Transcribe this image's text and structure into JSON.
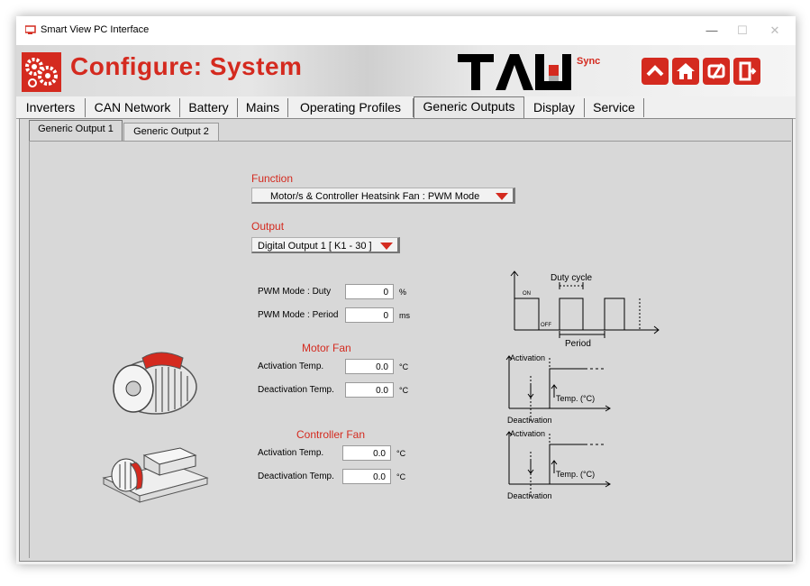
{
  "window": {
    "title": "Smart View PC Interface",
    "minimize": "—",
    "maximize": "☐",
    "close": "✕"
  },
  "header": {
    "page_title": "Configure: System",
    "brand": "TAU",
    "brand_sup": "Sync",
    "accent": "#d42a1f"
  },
  "tabs": [
    {
      "label": "Inverters"
    },
    {
      "label": "CAN Network"
    },
    {
      "label": "Battery"
    },
    {
      "label": "Mains"
    },
    {
      "label": "Operating Profiles"
    },
    {
      "label": "Generic Outputs"
    },
    {
      "label": "Display"
    },
    {
      "label": "Service"
    }
  ],
  "subtabs": [
    {
      "label": "Generic Output 1"
    },
    {
      "label": "Generic Output 2"
    }
  ],
  "function": {
    "label": "Function",
    "value": "Motor/s & Controller Heatsink Fan : PWM Mode"
  },
  "output": {
    "label": "Output",
    "value": "Digital Output 1  [ K1 - 30 ]"
  },
  "pwm": {
    "duty_label": "PWM Mode : Duty",
    "duty_value": "0",
    "duty_unit": "%",
    "period_label": "PWM Mode : Period",
    "period_value": "0",
    "period_unit": "ms"
  },
  "motor_fan": {
    "title": "Motor Fan",
    "activation_label": "Activation Temp.",
    "activation_value": "0.0",
    "activation_unit": "°C",
    "deactivation_label": "Deactivation Temp.",
    "deactivation_value": "0.0",
    "deactivation_unit": "°C"
  },
  "controller_fan": {
    "title": "Controller Fan",
    "activation_label": "Activation Temp.",
    "activation_value": "0.0",
    "activation_unit": "°C",
    "deactivation_label": "Deactivation Temp.",
    "deactivation_value": "0.0",
    "deactivation_unit": "°C"
  },
  "pwm_diagram": {
    "duty_cycle": "Duty cycle",
    "on": "ON",
    "off": "OFF",
    "period": "Period"
  },
  "hyst_diagram": {
    "activation": "Activation",
    "deactivation": "Deactivation",
    "temp": "Temp. (°C)"
  }
}
